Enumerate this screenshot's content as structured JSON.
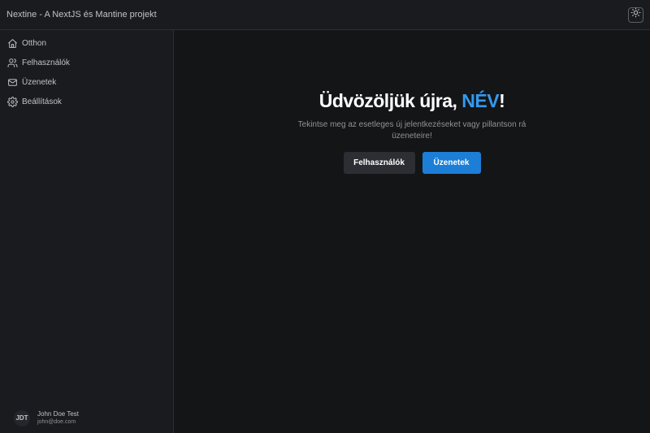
{
  "header": {
    "title": "Nextine - A NextJS és Mantine projekt",
    "theme_toggle_icon": "sun-icon"
  },
  "sidebar": {
    "items": [
      {
        "label": "Otthon",
        "icon": "home-icon"
      },
      {
        "label": "Felhasználók",
        "icon": "users-icon"
      },
      {
        "label": "Üzenetek",
        "icon": "mail-icon"
      },
      {
        "label": "Beállítások",
        "icon": "gear-icon"
      }
    ],
    "user": {
      "initials": "JDT",
      "name": "John Doe Test",
      "email": "john@doe.com"
    }
  },
  "main": {
    "title_prefix": "Üdvözöljük újra, ",
    "title_accent": "NÉV",
    "title_suffix": "!",
    "subtitle": "Tekintse meg az esetleges új jelentkezéseket vagy pillantson rá üzeneteire!",
    "buttons": {
      "users_label": "Felhasználók",
      "messages_label": "Üzenetek"
    }
  },
  "colors": {
    "background": "#1a1b1e",
    "main_background": "#141517",
    "accent": "#339af0",
    "primary_button": "#1c7ed6",
    "secondary_button": "#2c2e33"
  }
}
